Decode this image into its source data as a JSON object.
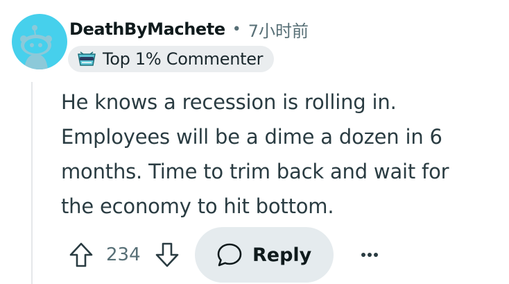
{
  "comment": {
    "username": "DeathByMachete",
    "separator": "•",
    "timestamp": "7小时前",
    "flair": {
      "icon": "crown-gem-icon",
      "text": "Top 1% Commenter"
    },
    "body_lines": [
      "He knows a recession is rolling in.",
      "Employees will be a dime a dozen in 6",
      "months. Time to trim back and wait for",
      "the economy to hit bottom."
    ]
  },
  "actions": {
    "upvote_icon": "upvote-arrow-icon",
    "vote_count": "234",
    "downvote_icon": "downvote-arrow-icon",
    "reply_icon": "speech-bubble-icon",
    "reply_label": "Reply",
    "more_icon": "ellipsis-icon"
  },
  "colors": {
    "avatar_bg": "#46d0ec",
    "flair_bg": "#eaedef",
    "reply_bg": "#e5ebee",
    "meta_text": "#576f76",
    "body_text": "#2a3c42"
  }
}
